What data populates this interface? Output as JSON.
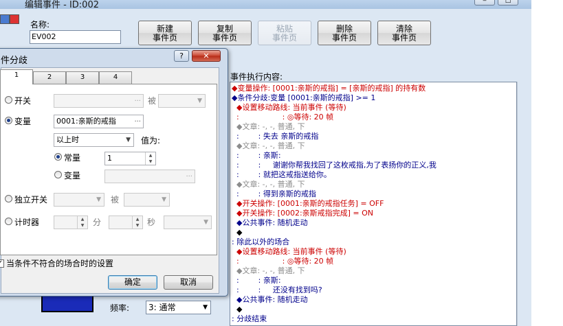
{
  "editor": {
    "title": "编辑事件 - ID:002",
    "name_label": "名称:",
    "name_value": "EV002",
    "page_buttons": {
      "new": [
        "新建",
        "事件页"
      ],
      "copy": [
        "复制",
        "事件页"
      ],
      "paste": [
        "粘贴",
        "事件页"
      ],
      "delete": [
        "删除",
        "事件页"
      ],
      "clear": [
        "清除",
        "事件页"
      ]
    },
    "content_label": "事件执行内容:",
    "frequency_label": "频率:",
    "frequency_value": "3: 通常"
  },
  "commands": [
    {
      "text": "◆变量操作: [0001:亲斯的戒指] = [亲斯的戒指] 的持有数",
      "color": "red"
    },
    {
      "text": "◆条件分歧:变量 [0001:亲斯的戒指] >= 1",
      "color": "blue"
    },
    {
      "text": "  ◆设置移动路线: 当前事件 (等待)",
      "color": "red"
    },
    {
      "text": "  :                  : ◎等待: 20 帧",
      "color": "red"
    },
    {
      "text": "  ◆文章: -, -, 普通, 下",
      "color": "gray"
    },
    {
      "text": "  :        : 失去 亲斯的戒指",
      "color": "blue"
    },
    {
      "text": "  ◆文章: -, -, 普通, 下",
      "color": "gray"
    },
    {
      "text": "  :        : 亲斯:",
      "color": "blue"
    },
    {
      "text": "  :        :     谢谢你帮我找回了这枚戒指,为了表扬你的正义,我",
      "color": "blue"
    },
    {
      "text": "  :        : 就把这戒指送给你。",
      "color": "blue"
    },
    {
      "text": "  ◆文章: -, -, 普通, 下",
      "color": "gray"
    },
    {
      "text": "  :        : 得到亲斯的戒指",
      "color": "blue"
    },
    {
      "text": "  ◆开关操作: [0001:亲斯的戒指任务] = OFF",
      "color": "red"
    },
    {
      "text": "  ◆开关操作: [0002:亲斯戒指完成] = ON",
      "color": "red"
    },
    {
      "text": "  ◆公共事件: 随机走动",
      "color": "blue"
    },
    {
      "text": "  ◆",
      "color": "black"
    },
    {
      "text": ": 除此以外的场合",
      "color": "blue"
    },
    {
      "text": "  ◆设置移动路线: 当前事件 (等待)",
      "color": "red"
    },
    {
      "text": "  :                  : ◎等待: 20 帧",
      "color": "red"
    },
    {
      "text": "  ◆文章: -, -, 普通, 下",
      "color": "gray"
    },
    {
      "text": "  :        : 亲斯:",
      "color": "blue"
    },
    {
      "text": "  :        :     还没有找到吗?",
      "color": "blue"
    },
    {
      "text": "  ◆公共事件: 随机走动",
      "color": "blue"
    },
    {
      "text": "  ◆",
      "color": "black"
    },
    {
      "text": ": 分歧结束",
      "color": "blue"
    }
  ],
  "dialog": {
    "title": "件分歧",
    "help": "?",
    "close": "✕",
    "tabs": [
      "1",
      "2",
      "3",
      "4"
    ],
    "switch_label": "开关",
    "switch_is": "被",
    "variable_label": "变量",
    "variable_value": "0001:亲斯的戒指",
    "compare_value": "以上时",
    "value_is": "值为:",
    "constant_label": "常量",
    "constant_value": "1",
    "variable2_label": "变量",
    "self_switch_label": "独立开关",
    "self_switch_is": "被",
    "timer_label": "计时器",
    "timer_min": "分",
    "timer_sec": "秒",
    "else_checkbox_label": "当条件不符合的场合时的设置",
    "ok": "确定",
    "cancel": "取消"
  }
}
